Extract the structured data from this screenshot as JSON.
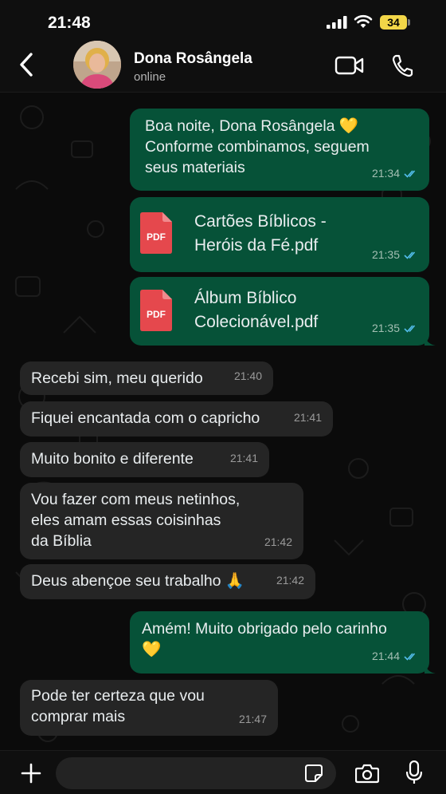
{
  "status_bar": {
    "time": "21:48",
    "battery": "34"
  },
  "header": {
    "contact_name": "Dona Rosângela",
    "presence": "online"
  },
  "messages": [
    {
      "dir": "out",
      "type": "text",
      "lines": [
        "Boa noite, Dona Rosângela 💛",
        "Conforme combinamos, seguem",
        "seus materiais"
      ],
      "time": "21:34",
      "read": true
    },
    {
      "dir": "out",
      "type": "file",
      "icon_label": "PDF",
      "lines": [
        "Cartões Bíblicos -",
        "Heróis da Fé.pdf"
      ],
      "time": "21:35",
      "read": true
    },
    {
      "dir": "out",
      "type": "file",
      "icon_label": "PDF",
      "lines": [
        "Álbum Bíblico",
        "Colecionável.pdf"
      ],
      "time": "21:35",
      "read": true
    },
    {
      "dir": "in",
      "type": "text",
      "lines": [
        "Recebi sim, meu querido"
      ],
      "time": "21:40"
    },
    {
      "dir": "in",
      "type": "text",
      "lines": [
        "Fiquei encantada com o capricho"
      ],
      "time": "21:41"
    },
    {
      "dir": "in",
      "type": "text",
      "lines": [
        "Muito bonito e diferente"
      ],
      "time": "21:41"
    },
    {
      "dir": "in",
      "type": "text",
      "lines": [
        "Vou fazer com meus netinhos,",
        "eles amam essas coisinhas",
        "da Bíblia"
      ],
      "time": "21:42"
    },
    {
      "dir": "in",
      "type": "text",
      "lines": [
        "Deus abençoe seu trabalho 🙏"
      ],
      "time": "21:42"
    },
    {
      "dir": "out",
      "type": "text",
      "lines": [
        "Amém! Muito obrigado pelo carinho",
        "💛"
      ],
      "time": "21:44",
      "read": true
    },
    {
      "dir": "in",
      "type": "text",
      "lines": [
        "Pode ter certeza que vou",
        "comprar mais"
      ],
      "time": "21:47"
    }
  ],
  "composer": {
    "placeholder": ""
  },
  "colors": {
    "outgoing_bubble": "#065238",
    "incoming_bubble": "#252525",
    "read_ticks": "#53bdeb",
    "pdf_red": "#e5484d"
  },
  "icons": [
    "back-chevron-icon",
    "video-call-icon",
    "phone-call-icon",
    "plus-icon",
    "sticker-icon",
    "camera-icon",
    "microphone-icon",
    "pdf-file-icon",
    "double-check-icon"
  ]
}
